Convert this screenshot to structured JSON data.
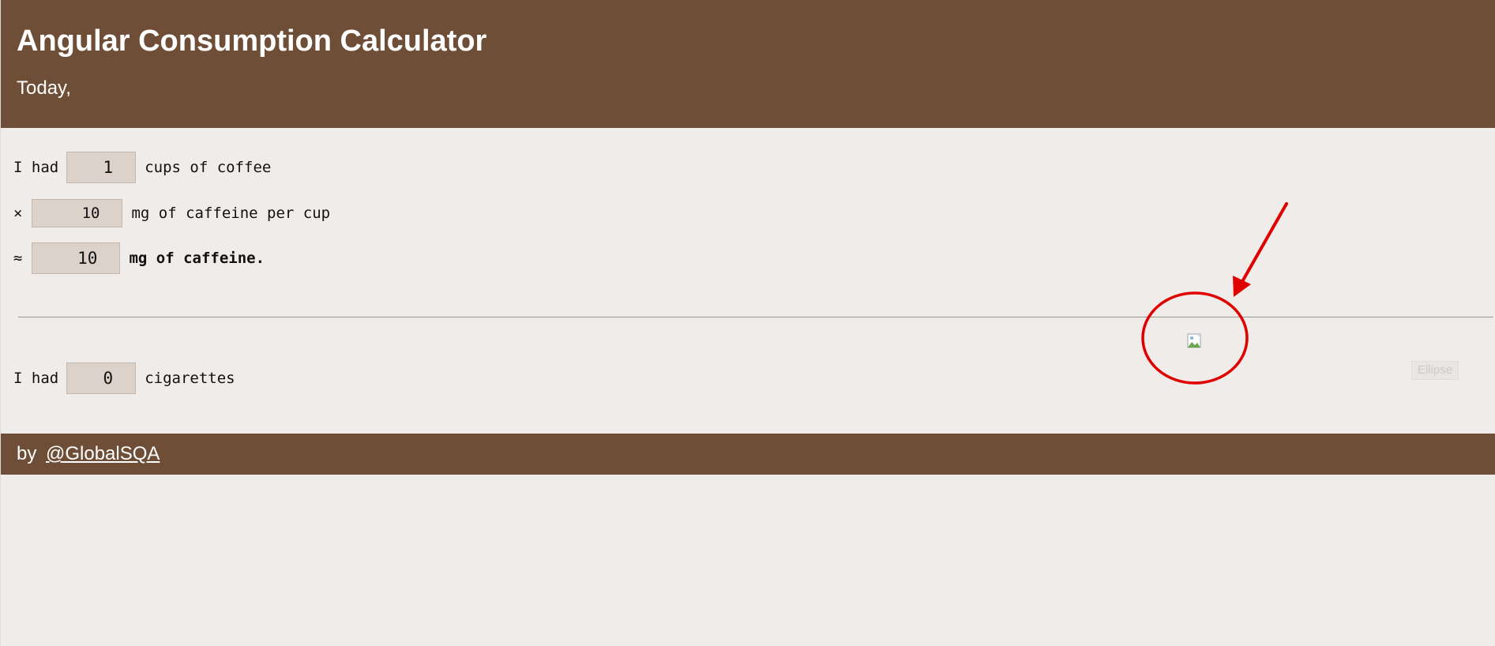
{
  "header": {
    "title": "Angular Consumption Calculator",
    "subtitle": "Today,"
  },
  "coffee": {
    "cups_prefix": "I had",
    "cups_value": "1",
    "cups_suffix": "cups of coffee",
    "multiply_symbol": "×",
    "caffeine_per_cup_value": "10",
    "caffeine_per_cup_suffix": "mg of caffeine per cup",
    "approx_symbol": "≈",
    "total_caffeine_value": "10",
    "total_caffeine_suffix": "mg of caffeine."
  },
  "cigarettes": {
    "prefix": "I had",
    "value": "0",
    "suffix": "cigarettes"
  },
  "overlay": {
    "broken_image_icon": "broken-image-icon",
    "ellipse_button_label": "Ellipse",
    "annotation_color": "#e00000"
  },
  "footer": {
    "by_label": "by",
    "link_text": "@GlobalSQA"
  },
  "colors": {
    "brand_brown": "#6f4e37",
    "page_background": "#f0ece9",
    "input_background": "#dcd2ca"
  }
}
